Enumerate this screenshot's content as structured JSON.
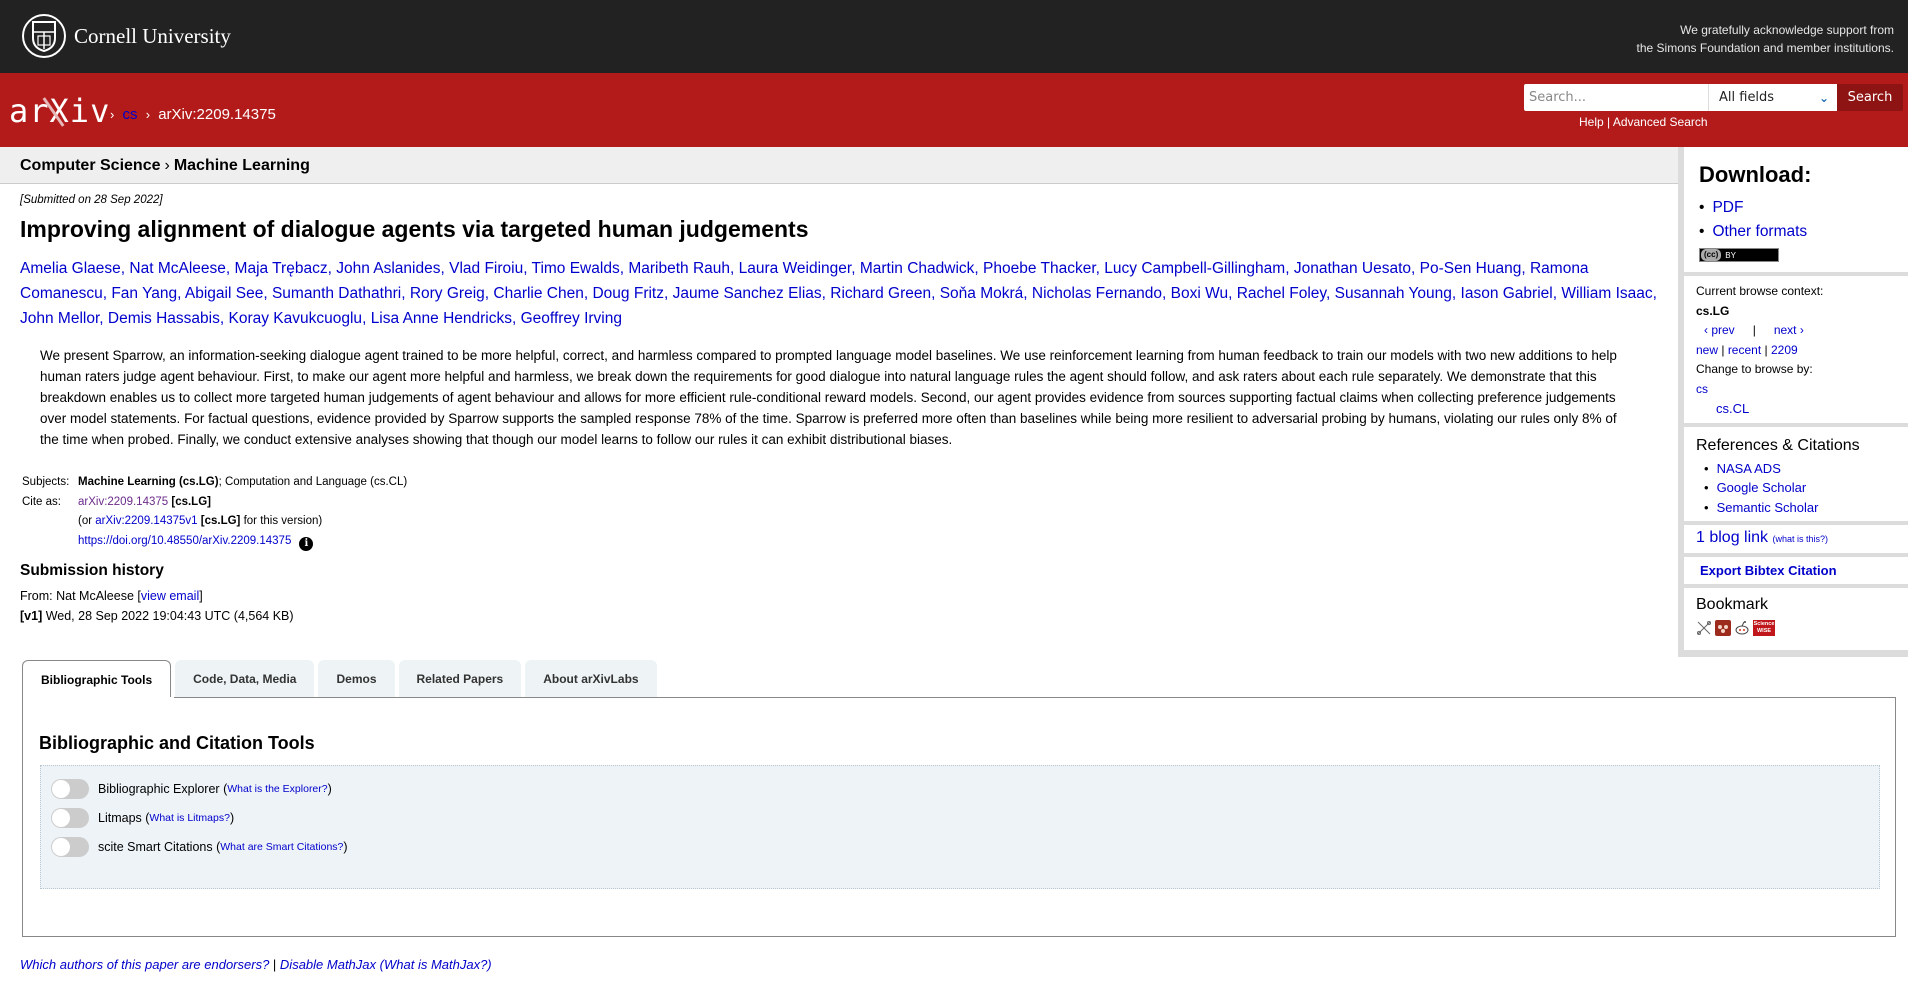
{
  "cornell": {
    "name": "Cornell University",
    "support_line1": "We gratefully acknowledge support from",
    "support_line2": "the Simons Foundation and member institutions."
  },
  "header": {
    "logo": "arXiv",
    "crumbs": [
      "cs",
      "arXiv:2209.14375"
    ],
    "search_placeholder": "Search...",
    "search_field_selected": "All fields",
    "search_button": "Search",
    "help_link": "Help",
    "advanced_link": "Advanced Search",
    "brand_color": "#b31b1b"
  },
  "subject_bar": {
    "parent": "Computer Science",
    "child": "Machine Learning"
  },
  "paper": {
    "dateline": "[Submitted on 28 Sep 2022]",
    "title": "Improving alignment of dialogue agents via targeted human judgements",
    "authors": [
      "Amelia Glaese",
      "Nat McAleese",
      "Maja Trębacz",
      "John Aslanides",
      "Vlad Firoiu",
      "Timo Ewalds",
      "Maribeth Rauh",
      "Laura Weidinger",
      "Martin Chadwick",
      "Phoebe Thacker",
      "Lucy Campbell-Gillingham",
      "Jonathan Uesato",
      "Po-Sen Huang",
      "Ramona Comanescu",
      "Fan Yang",
      "Abigail See",
      "Sumanth Dathathri",
      "Rory Greig",
      "Charlie Chen",
      "Doug Fritz",
      "Jaume Sanchez Elias",
      "Richard Green",
      "Soňa Mokrá",
      "Nicholas Fernando",
      "Boxi Wu",
      "Rachel Foley",
      "Susannah Young",
      "Iason Gabriel",
      "William Isaac",
      "John Mellor",
      "Demis Hassabis",
      "Koray Kavukcuoglu",
      "Lisa Anne Hendricks",
      "Geoffrey Irving"
    ],
    "abstract_lines": [
      "We present Sparrow, an information-seeking dialogue agent trained to be more helpful, correct, and harmless compared to prompted language model baselines. We use reinforcement learning from human feedback to train our models with two new additions to help",
      "human raters judge agent behaviour. First, to make our agent more helpful and harmless, we break down the requirements for good dialogue into natural language rules the agent should follow, and ask raters about each rule separately. We demonstrate that this",
      "breakdown enables us to collect more targeted human judgements of agent behaviour and allows for more efficient rule-conditional reward models. Second, our agent provides evidence from sources supporting factual claims when collecting preference judgements",
      "over model statements. For factual questions, evidence provided by Sparrow supports the sampled response 78% of the time. Sparrow is preferred more often than baselines while being more resilient to adversarial probing by humans, violating our rules only 8% of",
      "the time when probed. Finally, we conduct extensive analyses showing that though our model learns to follow our rules it can exhibit distributional biases."
    ],
    "subjects_label": "Subjects:",
    "subjects_primary": "Machine Learning (cs.LG)",
    "subjects_rest": "; Computation and Language (cs.CL)",
    "cite_label": "Cite as:",
    "cite_id": "arXiv:2209.14375",
    "cite_cat": "[cs.LG]",
    "cite_or": "(or ",
    "cite_version_id": "arXiv:2209.14375v1",
    "cite_version_suffix": " for this version)",
    "doi": "https://doi.org/10.48550/arXiv.2209.14375",
    "info_icon": "i"
  },
  "submission": {
    "heading": "Submission history",
    "from_label": "From: Nat McAleese [",
    "view_email": "view email",
    "from_close": "]",
    "version": "[v1]",
    "version_detail": " Wed, 28 Sep 2022 19:04:43 UTC (4,564 KB)"
  },
  "sidebar": {
    "download_heading": "Download:",
    "download_links": [
      "PDF",
      "Other formats"
    ],
    "license_badge": "CC BY",
    "browse_context_label": "Current browse context:",
    "browse_context": "cs.LG",
    "prev": "‹ prev",
    "next": "next ›",
    "new": "new",
    "recent": "recent",
    "month": "2209",
    "change_browse_label": "Change to browse by:",
    "browse_options": [
      "cs",
      "cs.CL"
    ],
    "refs_heading": "References & Citations",
    "refs_links": [
      "NASA ADS",
      "Google Scholar",
      "Semantic Scholar"
    ],
    "blog_link": "1 blog link",
    "blog_what": "(what is this?)",
    "bibtex": "Export Bibtex Citation",
    "bookmark_heading": "Bookmark",
    "bookmark_icons": [
      "bibsonomy-icon",
      "mendeley-icon",
      "reddit-icon",
      "sciencewise-icon"
    ],
    "sciencewise_text": "Science WISE"
  },
  "tabs": [
    {
      "label": "Bibliographic Tools",
      "active": true
    },
    {
      "label": "Code, Data, Media",
      "active": false
    },
    {
      "label": "Demos",
      "active": false
    },
    {
      "label": "Related Papers",
      "active": false
    },
    {
      "label": "About arXivLabs",
      "active": false
    }
  ],
  "tools": {
    "heading": "Bibliographic and Citation Tools",
    "items": [
      {
        "label": "Bibliographic Explorer",
        "help": "What is the Explorer?",
        "enabled": false
      },
      {
        "label": "Litmaps",
        "help": "What is Litmaps?",
        "enabled": false
      },
      {
        "label": "scite Smart Citations",
        "help": "What are Smart Citations?",
        "enabled": false
      }
    ]
  },
  "footer": {
    "endorsers": "Which authors of this paper are endorsers?",
    "separator": " | ",
    "mathjax": "Disable MathJax",
    "mathjax_what": "(What is MathJax?)"
  }
}
